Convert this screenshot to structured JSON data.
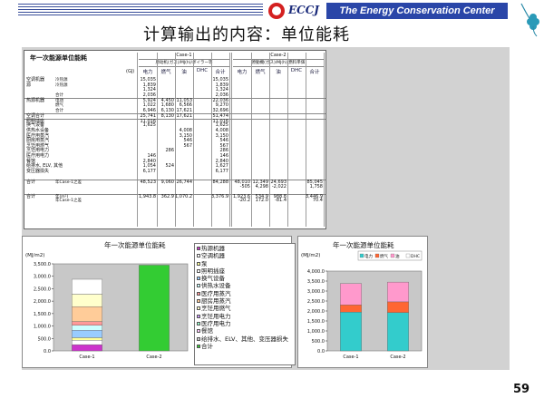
{
  "header": {
    "logo_text": "ECCJ",
    "org_name": "The Energy Conservation Center Japan",
    "title": "计算输出的内容：单位能耗"
  },
  "table": {
    "title": "年一次能源单位能耗",
    "unit": "(GJ)",
    "case1": "Case-1",
    "case2": "Case-2",
    "sub_case1": "原动机(ガス)/MJ(h)/ボイラー等",
    "sub_case2": "原動機(ガス)/MJ(h)/燃料単価",
    "columns": [
      "电力",
      "燃气",
      "油",
      "DHC",
      "合计",
      "电力",
      "燃气",
      "油",
      "DHC",
      "合计"
    ],
    "rows": [
      {
        "label": "空调机器",
        "sub": "冷热源",
        "c1": [
          "15,035",
          "",
          "",
          "",
          "15,035"
        ],
        "c2": [
          "",
          "",
          "",
          "",
          ""
        ]
      },
      {
        "label": "源",
        "sub": "冷热源",
        "c1": [
          "1,839",
          "",
          "",
          "",
          "1,839"
        ],
        "c2": [
          "",
          "",
          "",
          "",
          ""
        ]
      },
      {
        "label": "",
        "sub": "",
        "c1": [
          "1,324",
          "",
          "",
          "",
          "1,324"
        ],
        "c2": [
          "",
          "",
          "",
          "",
          ""
        ]
      },
      {
        "label": "",
        "sub": "合计",
        "c1": [
          "2,036",
          "",
          "",
          "",
          "2,036"
        ],
        "c2": [
          "",
          "",
          "",
          "",
          ""
        ]
      },
      {
        "label": "热源机器",
        "sub": "电动",
        "c1": [
          "5,924",
          "4,450",
          "11,053",
          "",
          "22,036"
        ],
        "c2": [
          "",
          "",
          "",
          "",
          ""
        ]
      },
      {
        "label": "",
        "sub": "燃气",
        "c1": [
          "1,022",
          "1,680",
          "6,566",
          "",
          "9,270"
        ],
        "c2": [
          "",
          "",
          "",
          "",
          ""
        ]
      },
      {
        "label": "",
        "sub": "合计",
        "c1": [
          "6,946",
          "6,130",
          "17,621",
          "",
          "32,696"
        ],
        "c2": [
          "",
          "",
          "",
          "",
          ""
        ]
      },
      {
        "label": "空调合计",
        "sub": "",
        "c1": [
          "25,741",
          "8,130",
          "17,621",
          "",
          "51,474"
        ],
        "c2": [
          "",
          "",
          "",
          "",
          ""
        ]
      },
      {
        "label": "照明插座",
        "sub": "",
        "c1": [
          "11,016",
          "",
          "",
          "",
          "11,016"
        ],
        "c2": [
          "",
          "",
          "",
          "",
          ""
        ]
      },
      {
        "label": "换气设备",
        "sub": "",
        "c1": [
          "1,625",
          "",
          "",
          "",
          "1,625"
        ],
        "c2": [
          "",
          "",
          "",
          "",
          ""
        ]
      },
      {
        "label": "供热水设备",
        "sub": "",
        "c1": [
          "",
          "",
          "4,008",
          "",
          "4,008"
        ],
        "c2": [
          "",
          "",
          "",
          "",
          ""
        ]
      },
      {
        "label": "医疗用蒸汽",
        "sub": "",
        "c1": [
          "",
          "",
          "3,150",
          "",
          "3,150"
        ],
        "c2": [
          "",
          "",
          "",
          "",
          ""
        ]
      },
      {
        "label": "厨房用蒸汽",
        "sub": "",
        "c1": [
          "",
          "",
          "546",
          "",
          "546"
        ],
        "c2": [
          "",
          "",
          "",
          "",
          ""
        ]
      },
      {
        "label": "烹饪用燃气",
        "sub": "",
        "c1": [
          "",
          "",
          "567",
          "",
          "567"
        ],
        "c2": [
          "",
          "",
          "",
          "",
          ""
        ]
      },
      {
        "label": "烹饪用电力",
        "sub": "",
        "c1": [
          "",
          "286",
          "",
          "",
          "286"
        ],
        "c2": [
          "",
          "",
          "",
          "",
          ""
        ]
      },
      {
        "label": "医疗用电力",
        "sub": "",
        "c1": [
          "146",
          "",
          "",
          "",
          "146"
        ],
        "c2": [
          "",
          "",
          "",
          "",
          ""
        ]
      },
      {
        "label": "餐馆",
        "sub": "",
        "c1": [
          "2,840",
          "",
          "",
          "",
          "2,840"
        ],
        "c2": [
          "",
          "",
          "",
          "",
          ""
        ]
      },
      {
        "label": "给排水, ELV, 其他",
        "sub": "",
        "c1": [
          "1,054",
          "524",
          "",
          "",
          "1,627"
        ],
        "c2": [
          "",
          "",
          "",
          "",
          ""
        ]
      },
      {
        "label": "变压器损失",
        "sub": "",
        "c1": [
          "6,177",
          "",
          "",
          "",
          "6,177"
        ],
        "c2": [
          "",
          "",
          "",
          "",
          ""
        ]
      },
      {
        "label": "合计",
        "sub": "年Case-1之差",
        "c1": [
          "48,523",
          "9,060",
          "26,744",
          "",
          "84,288"
        ],
        "c2": [
          "48,010",
          "12,349",
          "24,693",
          "",
          "85,045"
        ]
      },
      {
        "label": "",
        "sub": "",
        "c1": [
          "",
          "",
          "",
          "",
          ""
        ],
        "c2": [
          "-505",
          "4,298",
          "-2,022",
          "",
          "1,758"
        ]
      },
      {
        "label": "合计",
        "sub": "年(m²)",
        "c1": [
          "1,943.8",
          "362.9",
          "1,070.2",
          "",
          "3,376.9"
        ],
        "c2": [
          "1,923.6",
          "534.9",
          "988.8",
          "",
          "3,446.9"
        ]
      },
      {
        "label": "",
        "sub": "年Case-1之差",
        "c1": [
          "",
          "",
          "",
          "",
          ""
        ],
        "c2": [
          "-20.2",
          "172.0",
          "-81.4",
          "",
          "70.4"
        ]
      }
    ]
  },
  "chart_data": [
    {
      "type": "bar",
      "title": "年一次能源单位能耗",
      "ylabel": "(MJ/m2)",
      "categories": [
        "Case-1",
        "Case-2"
      ],
      "ylim": [
        0,
        3500
      ],
      "yticks": [
        "0.0",
        "500.0",
        "1,000.0",
        "1,500.0",
        "2,000.0",
        "2,500.0",
        "3,000.0",
        "3,500.0"
      ],
      "stacked": true,
      "series": [
        {
          "name": "热源机器",
          "color": "#cc33cc",
          "values": [
            250,
            0
          ]
        },
        {
          "name": "空调机器",
          "color": "#ffffff",
          "values": [
            180,
            0
          ]
        },
        {
          "name": "泵",
          "color": "#ffff99",
          "values": [
            100,
            0
          ]
        },
        {
          "name": "照明插座",
          "color": "#99ccff",
          "values": [
            300,
            0
          ]
        },
        {
          "name": "换气设备",
          "color": "#ccffff",
          "values": [
            200,
            0
          ]
        },
        {
          "name": "供热水设备",
          "color": "#ff9999",
          "values": [
            150,
            0
          ]
        },
        {
          "name": "医疗用蒸汽",
          "color": "#ffcc99",
          "values": [
            600,
            0
          ]
        },
        {
          "name": "厨房用蒸汽",
          "color": "#ffffcc",
          "values": [
            500,
            0
          ]
        },
        {
          "name": "烹饪用燃气",
          "color": "#ffffff",
          "values": [
            600,
            0
          ]
        },
        {
          "name": "合计",
          "color": "#33cc33",
          "values": [
            0,
            3447
          ]
        }
      ],
      "legend": [
        "热源机器",
        "空调机器",
        "泵",
        "照明插座",
        "换气设备",
        "供热水设备",
        "医疗用蒸汽",
        "厨房用蒸汽",
        "烹饪用燃气",
        "烹饪用电力",
        "医疗用电力",
        "餐馆",
        "给排水、ELV、其他、变压器损失",
        "合计"
      ],
      "legend_colors": [
        "#cc33cc",
        "#ffffff",
        "#ffff99",
        "#ffffff",
        "#99ccff",
        "#ccffff",
        "#ff9999",
        "#ffcc99",
        "#ffffcc",
        "#cc99ff",
        "#99ffcc",
        "#ffccff",
        "#cccccc",
        "#33cc33"
      ]
    },
    {
      "type": "bar",
      "title": "年一次能源单位能耗",
      "ylabel": "(MJ/m2)",
      "legend": [
        "电力",
        "燃气",
        "油",
        "DHC"
      ],
      "categories": [
        "Case-1",
        "Case-2"
      ],
      "ylim": [
        0,
        4000
      ],
      "yticks": [
        "0.0",
        "500.0",
        "1,000.0",
        "1,500.0",
        "2,000.0",
        "2,500.0",
        "3,000.0",
        "3,500.0",
        "4,000.0"
      ],
      "stacked": true,
      "series": [
        {
          "name": "电力",
          "color": "#33cccc",
          "values": [
            1944,
            1924
          ]
        },
        {
          "name": "燃气",
          "color": "#ff6633",
          "values": [
            363,
            535
          ]
        },
        {
          "name": "油",
          "color": "#ff99cc",
          "values": [
            1070,
            989
          ]
        },
        {
          "name": "DHC",
          "color": "#ffffff",
          "values": [
            0,
            0
          ]
        }
      ]
    }
  ],
  "page_number": "59"
}
